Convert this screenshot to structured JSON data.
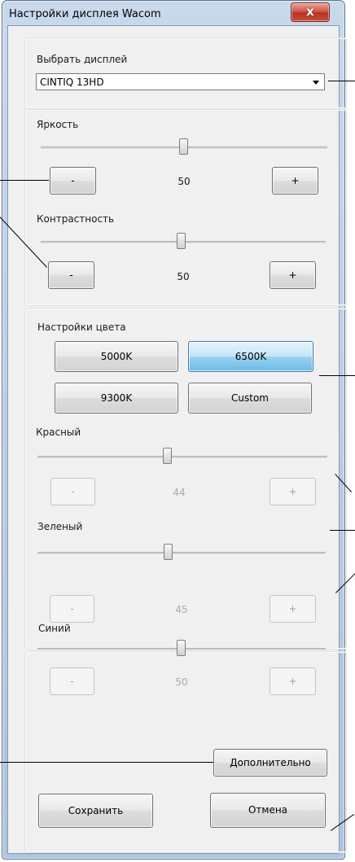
{
  "window": {
    "title": "Настройки дисплея Wacom",
    "close_symbol": "x"
  },
  "display": {
    "label": "Выбрать дисплей",
    "selected": "CINTIQ 13HD"
  },
  "brightness": {
    "label": "Яркость",
    "value": "50",
    "level": 0.5,
    "minus": "-",
    "plus": "+"
  },
  "contrast": {
    "label": "Контрастность",
    "value": "50",
    "level": 0.5,
    "minus": "-",
    "plus": "+"
  },
  "color": {
    "label": "Настройки цвета",
    "presets": [
      "5000K",
      "6500K",
      "9300K",
      "Custom"
    ],
    "selected_preset": "6500K",
    "red": {
      "label": "Красный",
      "value": "44",
      "minus": "-",
      "plus": "+"
    },
    "green": {
      "label": "Зеленый",
      "value": "45",
      "minus": "-",
      "plus": "+"
    },
    "blue": {
      "label": "Синий",
      "value": "50",
      "minus": "-",
      "plus": "+"
    }
  },
  "buttons": {
    "advanced": "Дополнительно",
    "save": "Сохранить",
    "cancel": "Отмена"
  },
  "colors": {
    "selected_preset_fill": "#6dbbe8",
    "disabled_text": "#a0a0a0",
    "frame_blue": "#b7cbe3"
  }
}
